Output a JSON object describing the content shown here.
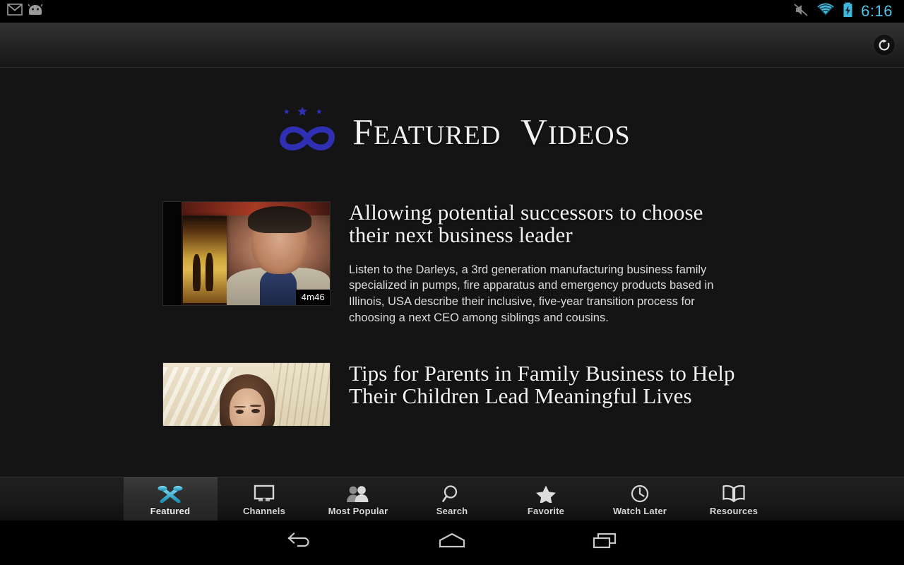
{
  "statusbar": {
    "time": "6:16",
    "icons_left": [
      "gmail-icon",
      "android-head-icon"
    ],
    "icons_right": [
      "mute-icon",
      "wifi-icon",
      "battery-charging-icon"
    ],
    "clock_color": "#4fc3e8"
  },
  "actionbar": {
    "refresh_label": "refresh-icon"
  },
  "brand": {
    "logo": "infinity-stars-logo",
    "logo_color": "#2f2fb4",
    "title_first": "F",
    "title_first_rest": "EATURED",
    "title_second": "V",
    "title_second_rest": "IDEOS",
    "title_full": "Featured Videos"
  },
  "videos": [
    {
      "title": "Allowing potential successors to choose their next business leader",
      "description": "Listen to the Darleys, a 3rd generation manufacturing business family specialized in pumps, fire apparatus and emergency products based in Illinois, USA describe their inclusive, five-year transition process for choosing a next CEO among siblings and cousins.",
      "duration": "4m46"
    },
    {
      "title": "Tips for Parents in Family Business to Help Their Children Lead Meaningful Lives",
      "description": "",
      "duration": ""
    }
  ],
  "tabs": [
    {
      "label": "Featured",
      "icon": "crossed-ribbons-icon",
      "selected": true
    },
    {
      "label": "Channels",
      "icon": "monitor-icon",
      "selected": false
    },
    {
      "label": "Most Popular",
      "icon": "people-icon",
      "selected": false
    },
    {
      "label": "Search",
      "icon": "search-icon",
      "selected": false
    },
    {
      "label": "Favorite",
      "icon": "star-icon",
      "selected": false
    },
    {
      "label": "Watch Later",
      "icon": "clock-icon",
      "selected": false
    },
    {
      "label": "Resources",
      "icon": "open-book-icon",
      "selected": false
    }
  ],
  "navbar": {
    "back": "back-icon",
    "home": "home-icon",
    "recents": "recents-icon"
  },
  "colors": {
    "accent_cyan": "#3fb8dc",
    "logo_blue": "#2f2fb4",
    "background": "#141414",
    "tabbar": "#1a1a1a"
  }
}
